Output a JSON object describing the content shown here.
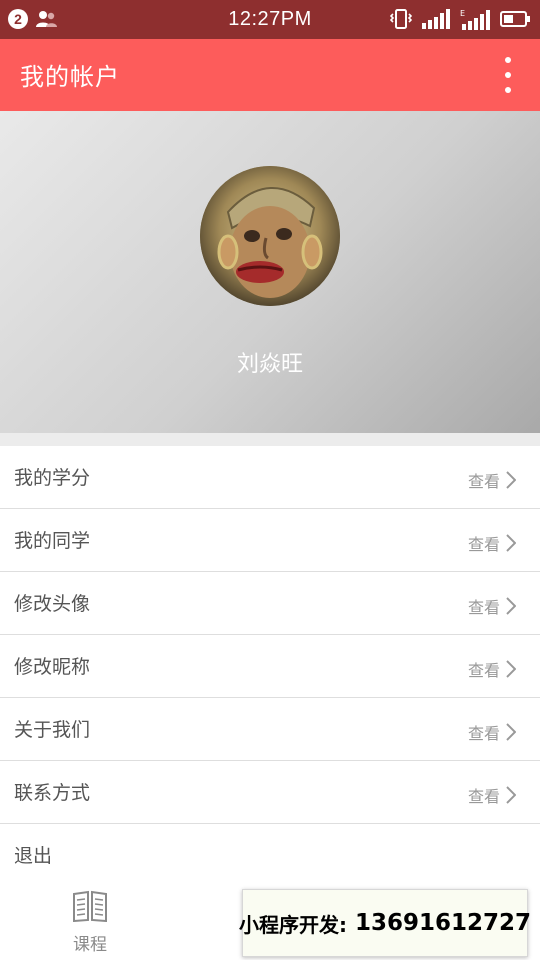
{
  "status_bar": {
    "notification_count": "2",
    "time": "12:27PM",
    "icons": [
      "person-icon",
      "vibrate-icon",
      "signal-icon",
      "signal-e-icon",
      "battery-icon"
    ]
  },
  "app_bar": {
    "title": "我的帐户",
    "menu_icon": "more-vert-icon"
  },
  "profile": {
    "username": "刘焱旺"
  },
  "menu": {
    "view_label": "查看",
    "items": [
      {
        "label": "我的学分"
      },
      {
        "label": "我的同学"
      },
      {
        "label": "修改头像"
      },
      {
        "label": "修改昵称"
      },
      {
        "label": "关于我们"
      },
      {
        "label": "联系方式"
      }
    ],
    "logout_label": "退出"
  },
  "bottom_tab": {
    "course_label": "课程",
    "course_icon": "book-icon"
  },
  "watermark": {
    "prefix": "小程序开发:",
    "phone": "13691612727"
  },
  "colors": {
    "status_bar": "#8e2f2f",
    "accent": "#fd5c5b"
  }
}
